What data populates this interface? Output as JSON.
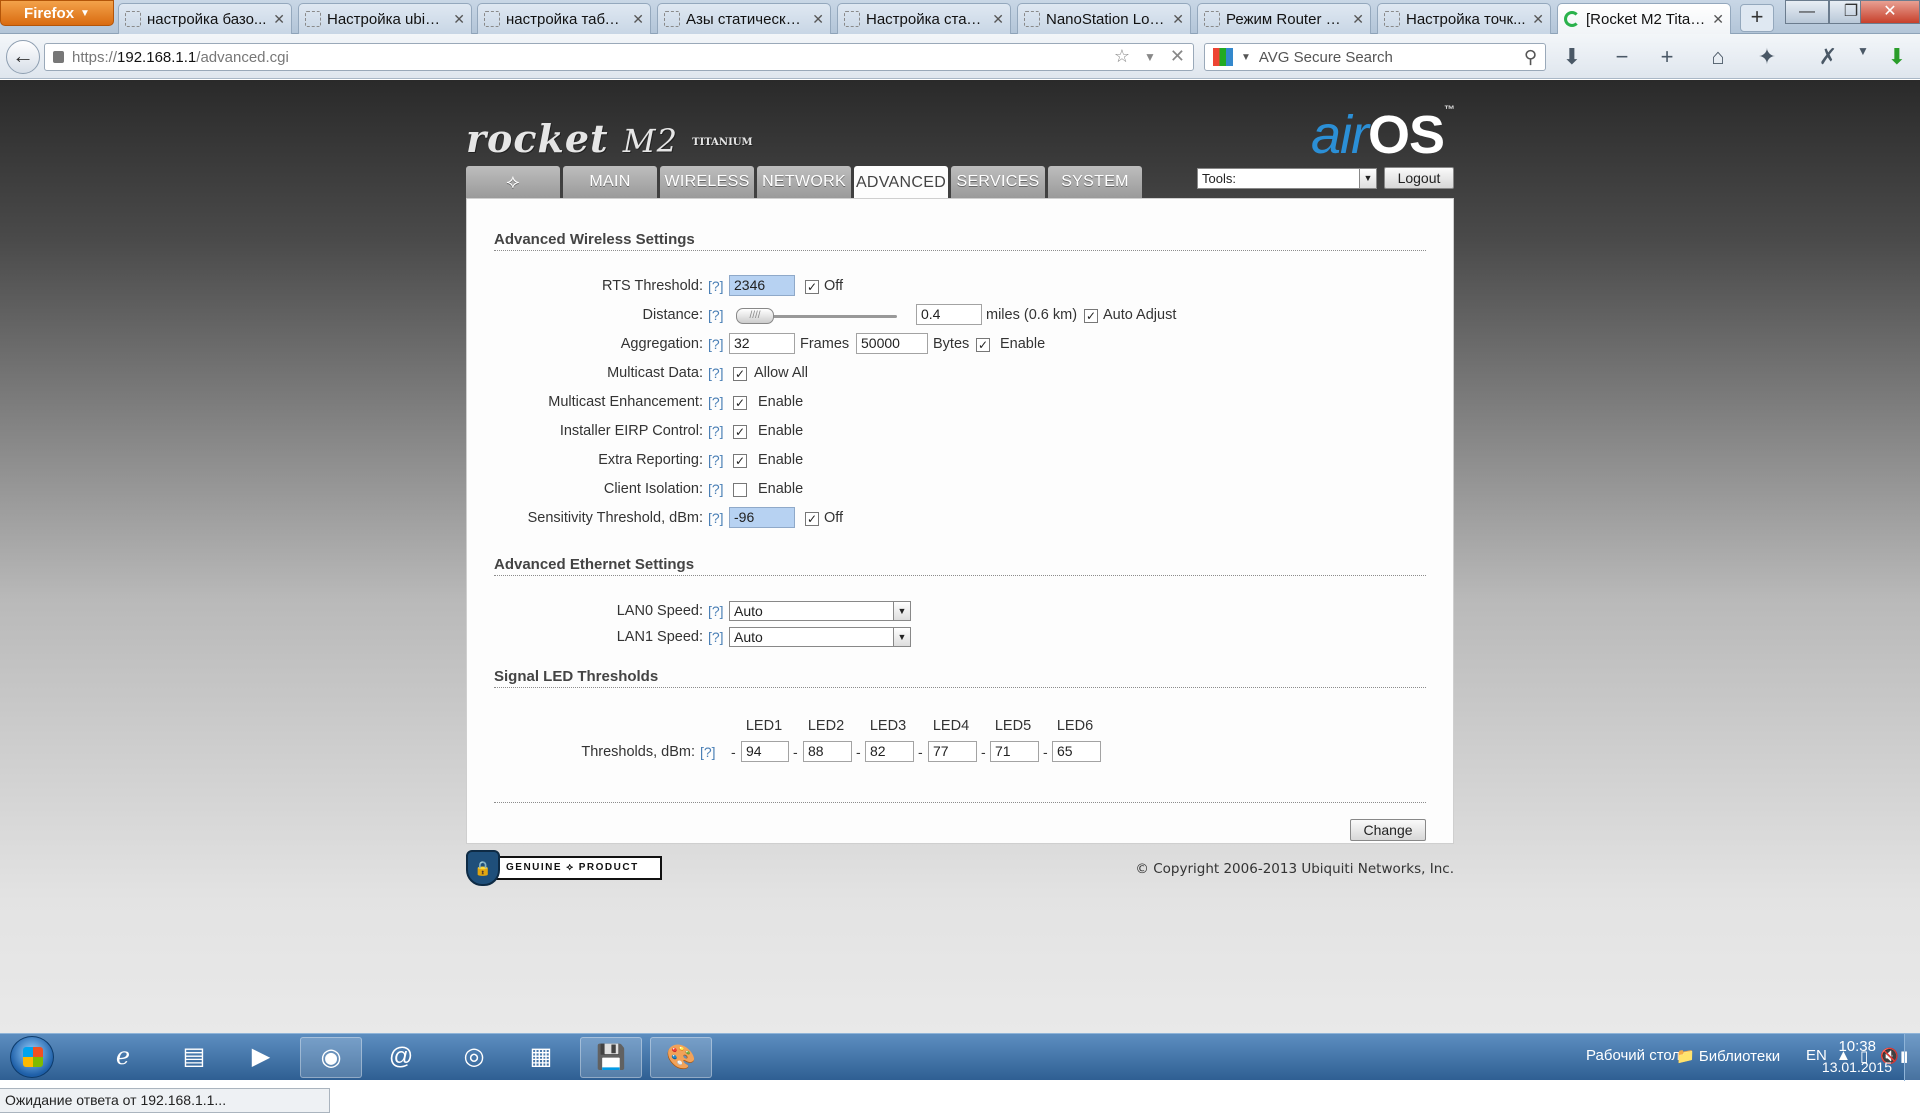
{
  "browser": {
    "menu_label": "Firefox",
    "tabs": [
      {
        "title": "настройка базо..."
      },
      {
        "title": "Настройка ubiqu..."
      },
      {
        "title": "настройка табли..."
      },
      {
        "title": "Азы статической..."
      },
      {
        "title": "Настройка стати..."
      },
      {
        "title": "NanoStation Loc..."
      },
      {
        "title": "Режим Router —..."
      },
      {
        "title": "Настройка точк..."
      },
      {
        "title": "[Rocket M2 Titani..."
      }
    ],
    "url_scheme": "https://",
    "url_host": "192.168.1.1",
    "url_path": "/advanced.cgi",
    "search_placeholder": "AVG Secure Search",
    "status_text": "Ожидание ответа от 192.168.1.1..."
  },
  "device": {
    "logo_main": "rocket",
    "logo_model": "M2",
    "logo_sub": "TITANIUM",
    "brand_air": "air",
    "brand_os": "OS",
    "brand_tm": "™"
  },
  "nav": {
    "tabs": [
      "MAIN",
      "WIRELESS",
      "NETWORK",
      "ADVANCED",
      "SERVICES",
      "SYSTEM"
    ],
    "active_tab": "ADVANCED",
    "tools_label": "Tools:",
    "logout_label": "Logout"
  },
  "help_label": "[?]",
  "wireless": {
    "title": "Advanced Wireless Settings",
    "rts": {
      "label": "RTS Threshold:",
      "value": "2346",
      "checkbox_label": "Off",
      "checked": true
    },
    "distance": {
      "label": "Distance:",
      "value": "0.4",
      "units": "miles (0.6 km)",
      "checkbox_label": "Auto Adjust",
      "checked": true
    },
    "aggregation": {
      "label": "Aggregation:",
      "frames": "32",
      "frames_label": "Frames",
      "bytes": "50000",
      "bytes_label": "Bytes",
      "checkbox_label": "Enable",
      "checked": true
    },
    "multicast_data": {
      "label": "Multicast Data:",
      "checkbox_label": "Allow All",
      "checked": true
    },
    "multicast_enh": {
      "label": "Multicast Enhancement:",
      "checkbox_label": "Enable",
      "checked": true
    },
    "eirp": {
      "label": "Installer EIRP Control:",
      "checkbox_label": "Enable",
      "checked": true
    },
    "extra_reporting": {
      "label": "Extra Reporting:",
      "checkbox_label": "Enable",
      "checked": true
    },
    "client_isolation": {
      "label": "Client Isolation:",
      "checkbox_label": "Enable",
      "checked": false
    },
    "sensitivity": {
      "label": "Sensitivity Threshold, dBm:",
      "value": "-96",
      "checkbox_label": "Off",
      "checked": true
    }
  },
  "ethernet": {
    "title": "Advanced Ethernet Settings",
    "lan0": {
      "label": "LAN0 Speed:",
      "value": "Auto"
    },
    "lan1": {
      "label": "LAN1 Speed:",
      "value": "Auto"
    }
  },
  "leds": {
    "title": "Signal LED Thresholds",
    "label": "Thresholds, dBm:",
    "sign": "-",
    "headers": [
      "LED1",
      "LED2",
      "LED3",
      "LED4",
      "LED5",
      "LED6"
    ],
    "values": [
      "94",
      "88",
      "82",
      "77",
      "71",
      "65"
    ]
  },
  "change_label": "Change",
  "genuine_label": "GENUINE ⟡ PRODUCT",
  "copyright": "© Copyright 2006-2013 Ubiquiti Networks, Inc.",
  "taskbar": {
    "desktop_label": "Рабочий стол",
    "libraries_label": "Библиотеки",
    "lang": "EN",
    "time": "10:38",
    "date": "13.01.2015"
  }
}
